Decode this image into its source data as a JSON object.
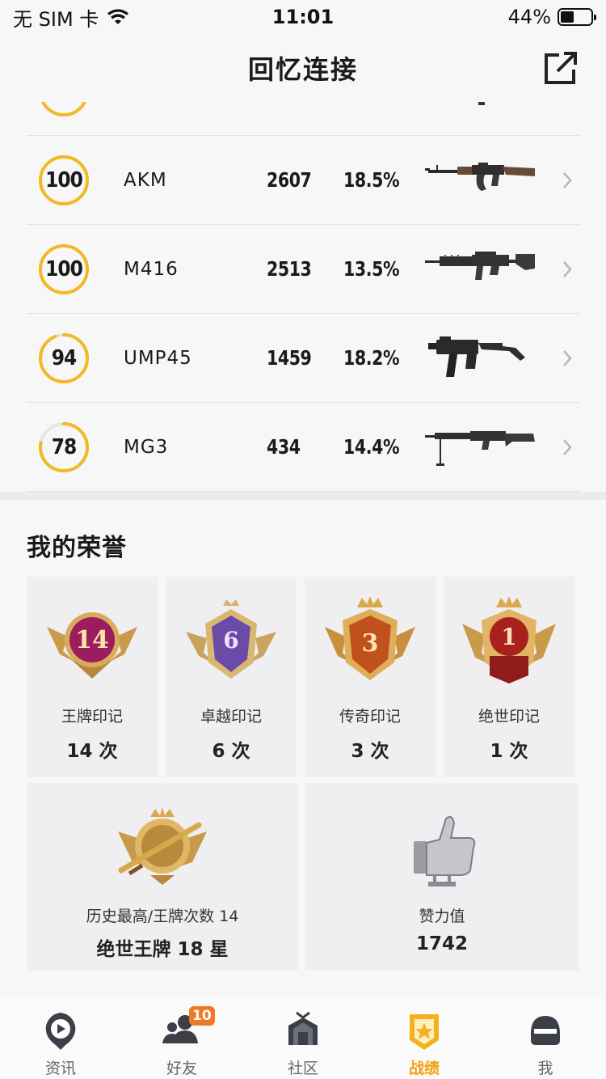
{
  "status_bar": {
    "carrier": "无 SIM 卡",
    "time": "11:01",
    "battery": "44%",
    "battery_level": 0.44
  },
  "header": {
    "title": "回忆连接",
    "share_icon": "share-external-icon"
  },
  "weapons": [
    {
      "score": "",
      "score_value": 85,
      "name": "",
      "kills": "",
      "rate": "",
      "partial": true
    },
    {
      "score": "100",
      "score_value": 100,
      "name": "AKM",
      "kills": "2607",
      "rate": "18.5%",
      "gun": "akm"
    },
    {
      "score": "100",
      "score_value": 100,
      "name": "M416",
      "kills": "2513",
      "rate": "13.5%",
      "gun": "m416"
    },
    {
      "score": "94",
      "score_value": 94,
      "name": "UMP45",
      "kills": "1459",
      "rate": "18.2%",
      "gun": "ump45"
    },
    {
      "score": "78",
      "score_value": 78,
      "name": "MG3",
      "kills": "434",
      "rate": "14.4%",
      "gun": "mg3"
    }
  ],
  "honor": {
    "title": "我的荣誉",
    "cards": [
      {
        "badge_number": "14",
        "label": "王牌印记",
        "value": "14 次",
        "color": "#9b1d5e"
      },
      {
        "badge_number": "6",
        "label": "卓越印记",
        "value": "6 次",
        "color": "#6b4aa8"
      },
      {
        "badge_number": "3",
        "label": "传奇印记",
        "value": "3 次",
        "color": "#c0501c"
      },
      {
        "badge_number": "1",
        "label": "绝世印记",
        "value": "1 次",
        "color": "#a8211f"
      }
    ],
    "rank_card": {
      "label": "历史最高/王牌次数 14",
      "value": "绝世王牌 18 星"
    },
    "like_card": {
      "label": "赞力值",
      "value": "1742"
    }
  },
  "tab_bar": {
    "tabs": [
      {
        "label": "资讯",
        "icon": "news-play-icon"
      },
      {
        "label": "好友",
        "icon": "friends-icon",
        "badge": "10"
      },
      {
        "label": "社区",
        "icon": "community-icon"
      },
      {
        "label": "战绩",
        "icon": "record-badge-icon",
        "active": true
      },
      {
        "label": "我",
        "icon": "helmet-icon"
      }
    ]
  },
  "colors": {
    "ring": "#f3b824",
    "ring_track": "#e6e6e9",
    "accent": "#f1a10c",
    "badge": "#ef7a23"
  }
}
